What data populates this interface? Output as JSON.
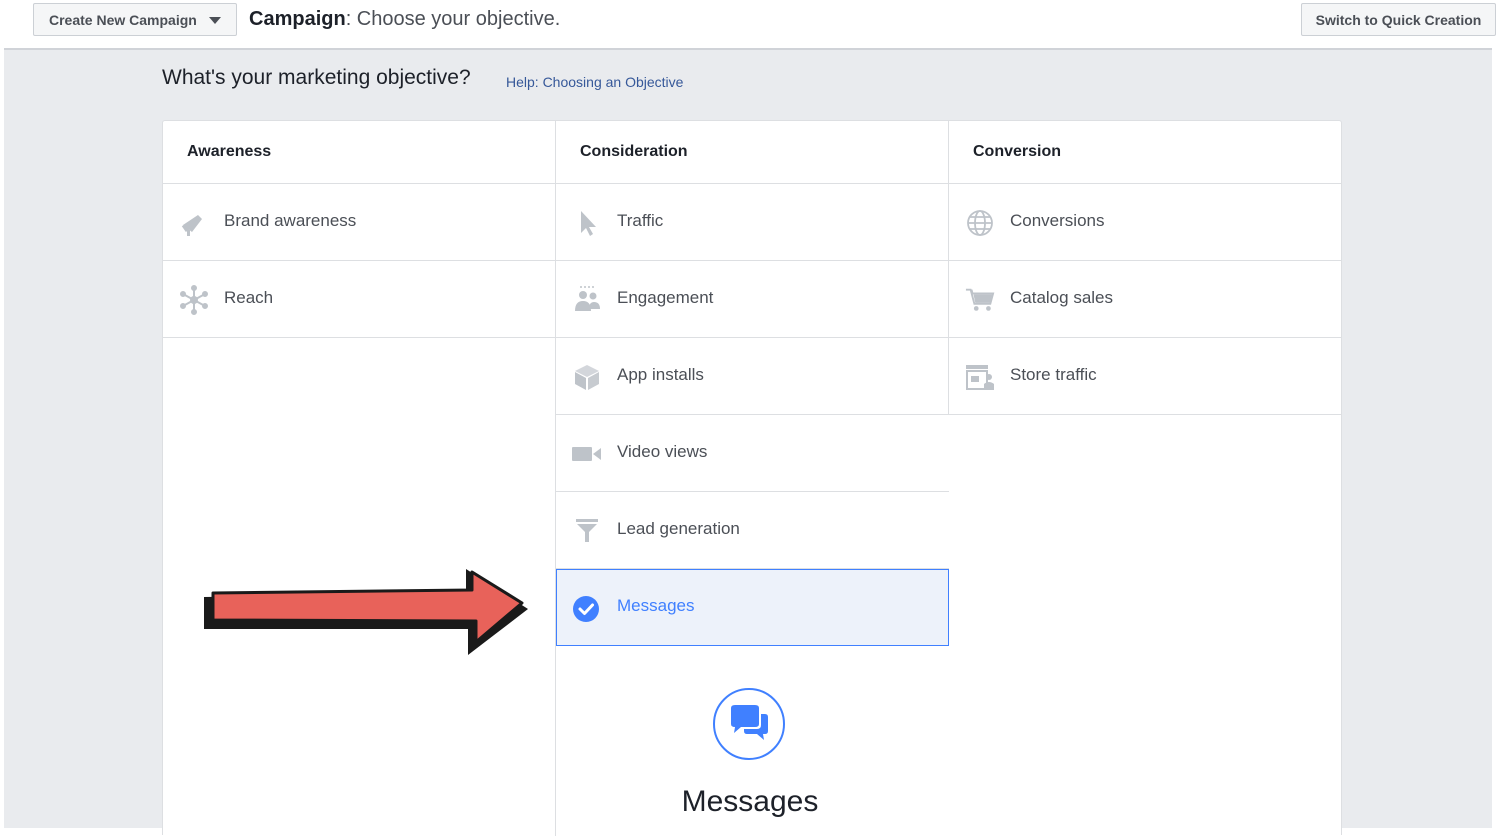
{
  "header": {
    "create_button_label": "Create New Campaign",
    "title_bold": "Campaign",
    "title_rest": ": Choose your objective.",
    "quick_creation_label": "Switch to Quick Creation"
  },
  "question": "What's your marketing objective?",
  "help_link": "Help: Choosing an Objective",
  "columns": [
    {
      "title": "Awareness",
      "items": [
        {
          "label": "Brand awareness",
          "icon": "megaphone-icon"
        },
        {
          "label": "Reach",
          "icon": "reach-icon"
        }
      ]
    },
    {
      "title": "Consideration",
      "items": [
        {
          "label": "Traffic",
          "icon": "cursor-icon"
        },
        {
          "label": "Engagement",
          "icon": "people-icon"
        },
        {
          "label": "App installs",
          "icon": "box-icon"
        },
        {
          "label": "Video views",
          "icon": "video-camera-icon"
        },
        {
          "label": "Lead generation",
          "icon": "funnel-icon"
        },
        {
          "label": "Messages",
          "icon": "check-circle-icon",
          "selected": true
        }
      ]
    },
    {
      "title": "Conversion",
      "items": [
        {
          "label": "Conversions",
          "icon": "globe-icon"
        },
        {
          "label": "Catalog sales",
          "icon": "cart-icon"
        },
        {
          "label": "Store traffic",
          "icon": "store-icon"
        }
      ]
    }
  ],
  "detail": {
    "title": "Messages",
    "icon": "chat-bubbles-icon"
  },
  "colors": {
    "accent": "#4080ff",
    "link": "#365899",
    "arrow_fill": "#e8625a",
    "arrow_outline": "#1a1a1a"
  }
}
